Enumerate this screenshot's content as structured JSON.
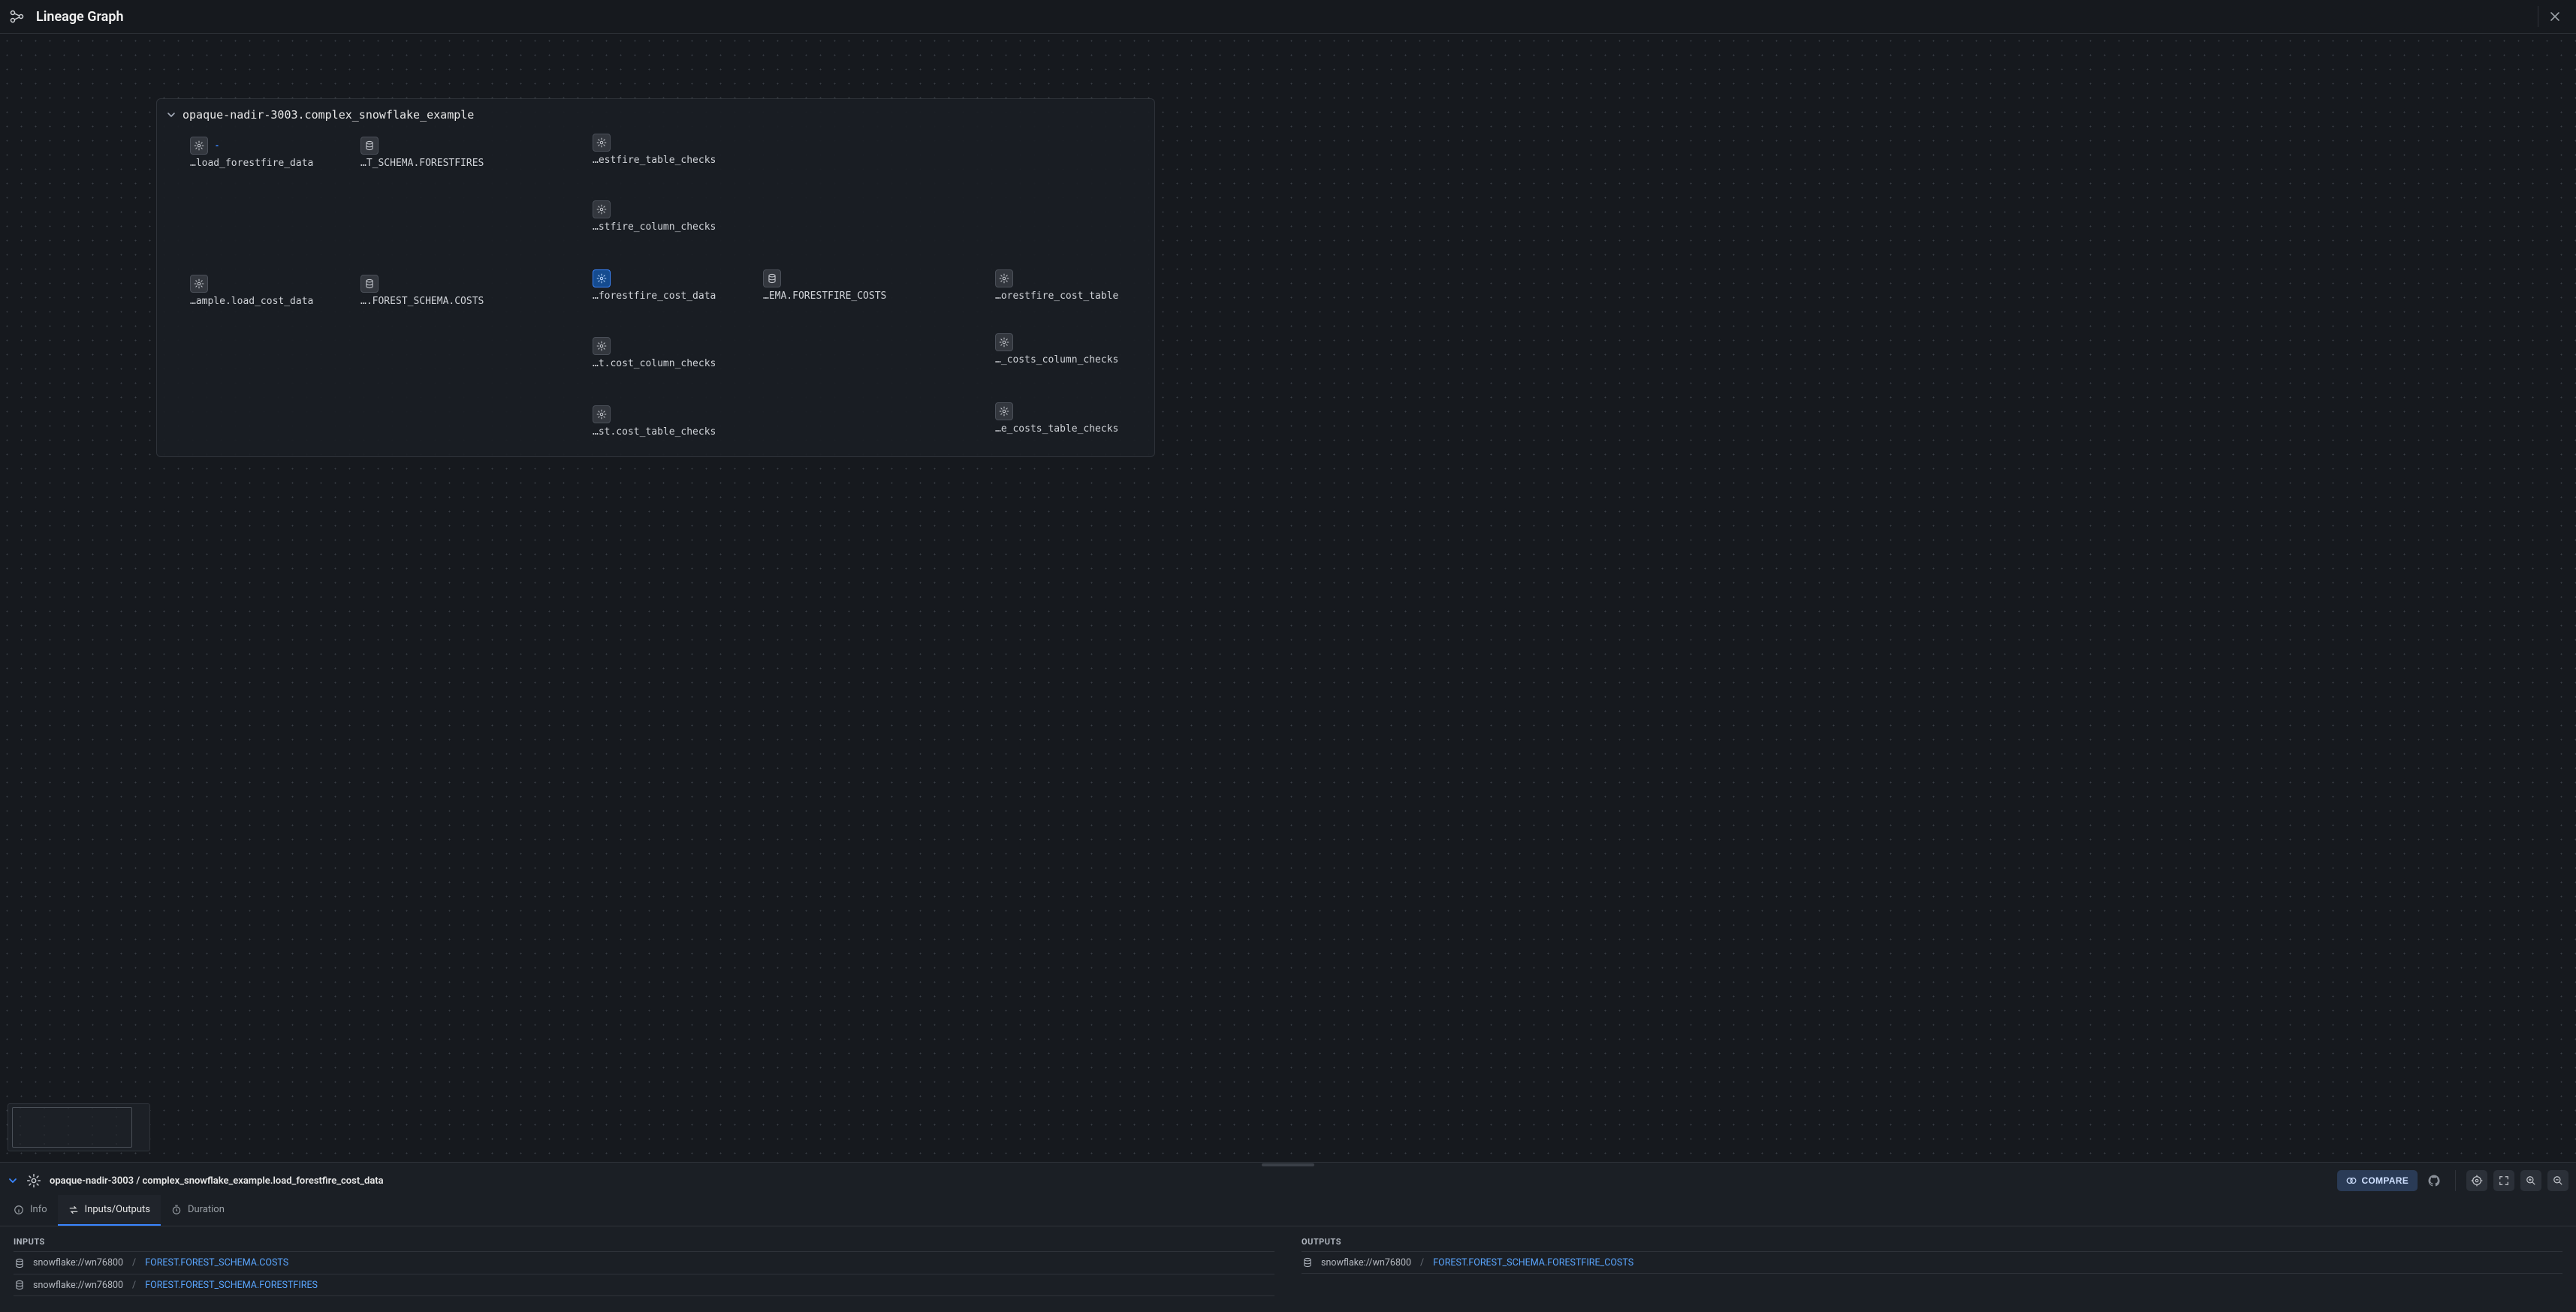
{
  "header": {
    "title": "Lineage Graph"
  },
  "group": {
    "title": "opaque-nadir-3003.complex_snowflake_example"
  },
  "nodes": {
    "n1": {
      "label": "…load_forestfire_data",
      "icon": "gear"
    },
    "n2": {
      "label": "…T_SCHEMA.FORESTFIRES",
      "icon": "db"
    },
    "n3": {
      "label": "…estfire_table_checks",
      "icon": "gear"
    },
    "n4": {
      "label": "…stfire_column_checks",
      "icon": "gear"
    },
    "n5": {
      "label": "…ample.load_cost_data",
      "icon": "gear"
    },
    "n6": {
      "label": "….FOREST_SCHEMA.COSTS",
      "icon": "db"
    },
    "n7": {
      "label": "…forestfire_cost_data",
      "icon": "gear",
      "selected": true
    },
    "n8": {
      "label": "…t.cost_column_checks",
      "icon": "gear"
    },
    "n9": {
      "label": "…st.cost_table_checks",
      "icon": "gear"
    },
    "n10": {
      "label": "…EMA.FORESTFIRE_COSTS",
      "icon": "db"
    },
    "n11": {
      "label": "…orestfire_cost_table",
      "icon": "gear"
    },
    "n12": {
      "label": "…_costs_column_checks",
      "icon": "gear"
    },
    "n13": {
      "label": "…e_costs_table_checks",
      "icon": "gear"
    }
  },
  "breadcrumb": {
    "text": "opaque-nadir-3003 / complex_snowflake_example.load_forestfire_cost_data",
    "compare_label": "COMPARE"
  },
  "tabs": {
    "info": "Info",
    "io": "Inputs/Outputs",
    "duration": "Duration"
  },
  "io": {
    "inputs_heading": "INPUTS",
    "outputs_heading": "OUTPUTS",
    "inputs": [
      {
        "host": "snowflake://wn76800",
        "path": "FOREST.FOREST_SCHEMA.COSTS"
      },
      {
        "host": "snowflake://wn76800",
        "path": "FOREST.FOREST_SCHEMA.FORESTFIRES"
      }
    ],
    "outputs": [
      {
        "host": "snowflake://wn76800",
        "path": "FOREST.FOREST_SCHEMA.FORESTFIRE_COSTS"
      }
    ]
  }
}
